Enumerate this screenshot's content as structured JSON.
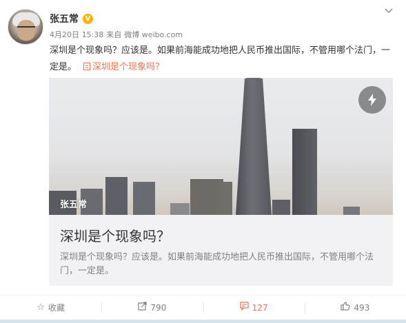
{
  "author": {
    "name": "张五常",
    "verified_badge": "V"
  },
  "meta": {
    "date": "4月20日 15:38",
    "source_prefix": "来自",
    "source": "微博 weibo.com"
  },
  "post": {
    "text": "深圳是个现象吗？应该是。如果前海能成功地把人民币推出国际，不管用哪个法门，一定是。",
    "link_label": "深圳是个现象吗？"
  },
  "card": {
    "image_label": "张五常",
    "title": "深圳是个现象吗？",
    "description": "深圳是个现象吗？应该是。如果前海能成功地把人民币推出国际，不管用哪个法门，一定是。"
  },
  "actions": {
    "favorite_label": "收藏",
    "repost_count": "790",
    "comment_count": "127",
    "like_count": "493"
  },
  "colors": {
    "accent": "#eb7350",
    "verified": "#ffb400"
  }
}
